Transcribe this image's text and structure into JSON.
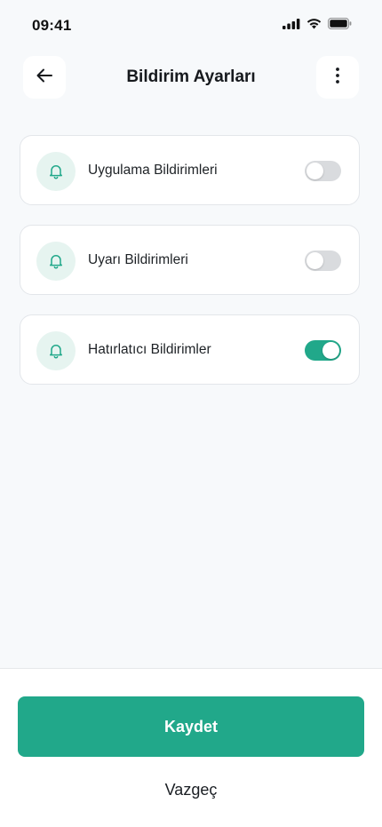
{
  "status_bar": {
    "time": "09:41",
    "icons": [
      "signal-icon",
      "wifi-icon",
      "battery-icon"
    ]
  },
  "header": {
    "title": "Bildirim Ayarları",
    "back_icon": "arrow-left-icon",
    "more_icon": "more-vertical-icon"
  },
  "settings": [
    {
      "label": "Uygulama Bildirimleri",
      "icon": "bell-icon",
      "enabled": false
    },
    {
      "label": "Uyarı Bildirimleri",
      "icon": "bell-icon",
      "enabled": false
    },
    {
      "label": "Hatırlatıcı Bildirimler",
      "icon": "bell-icon",
      "enabled": true
    }
  ],
  "actions": {
    "save_label": "Kaydet",
    "cancel_label": "Vazgeç"
  },
  "colors": {
    "accent": "#21a88a",
    "icon_bg": "#e6f4f0",
    "toggle_off": "#d9dbde",
    "background": "#f7f9fb"
  }
}
